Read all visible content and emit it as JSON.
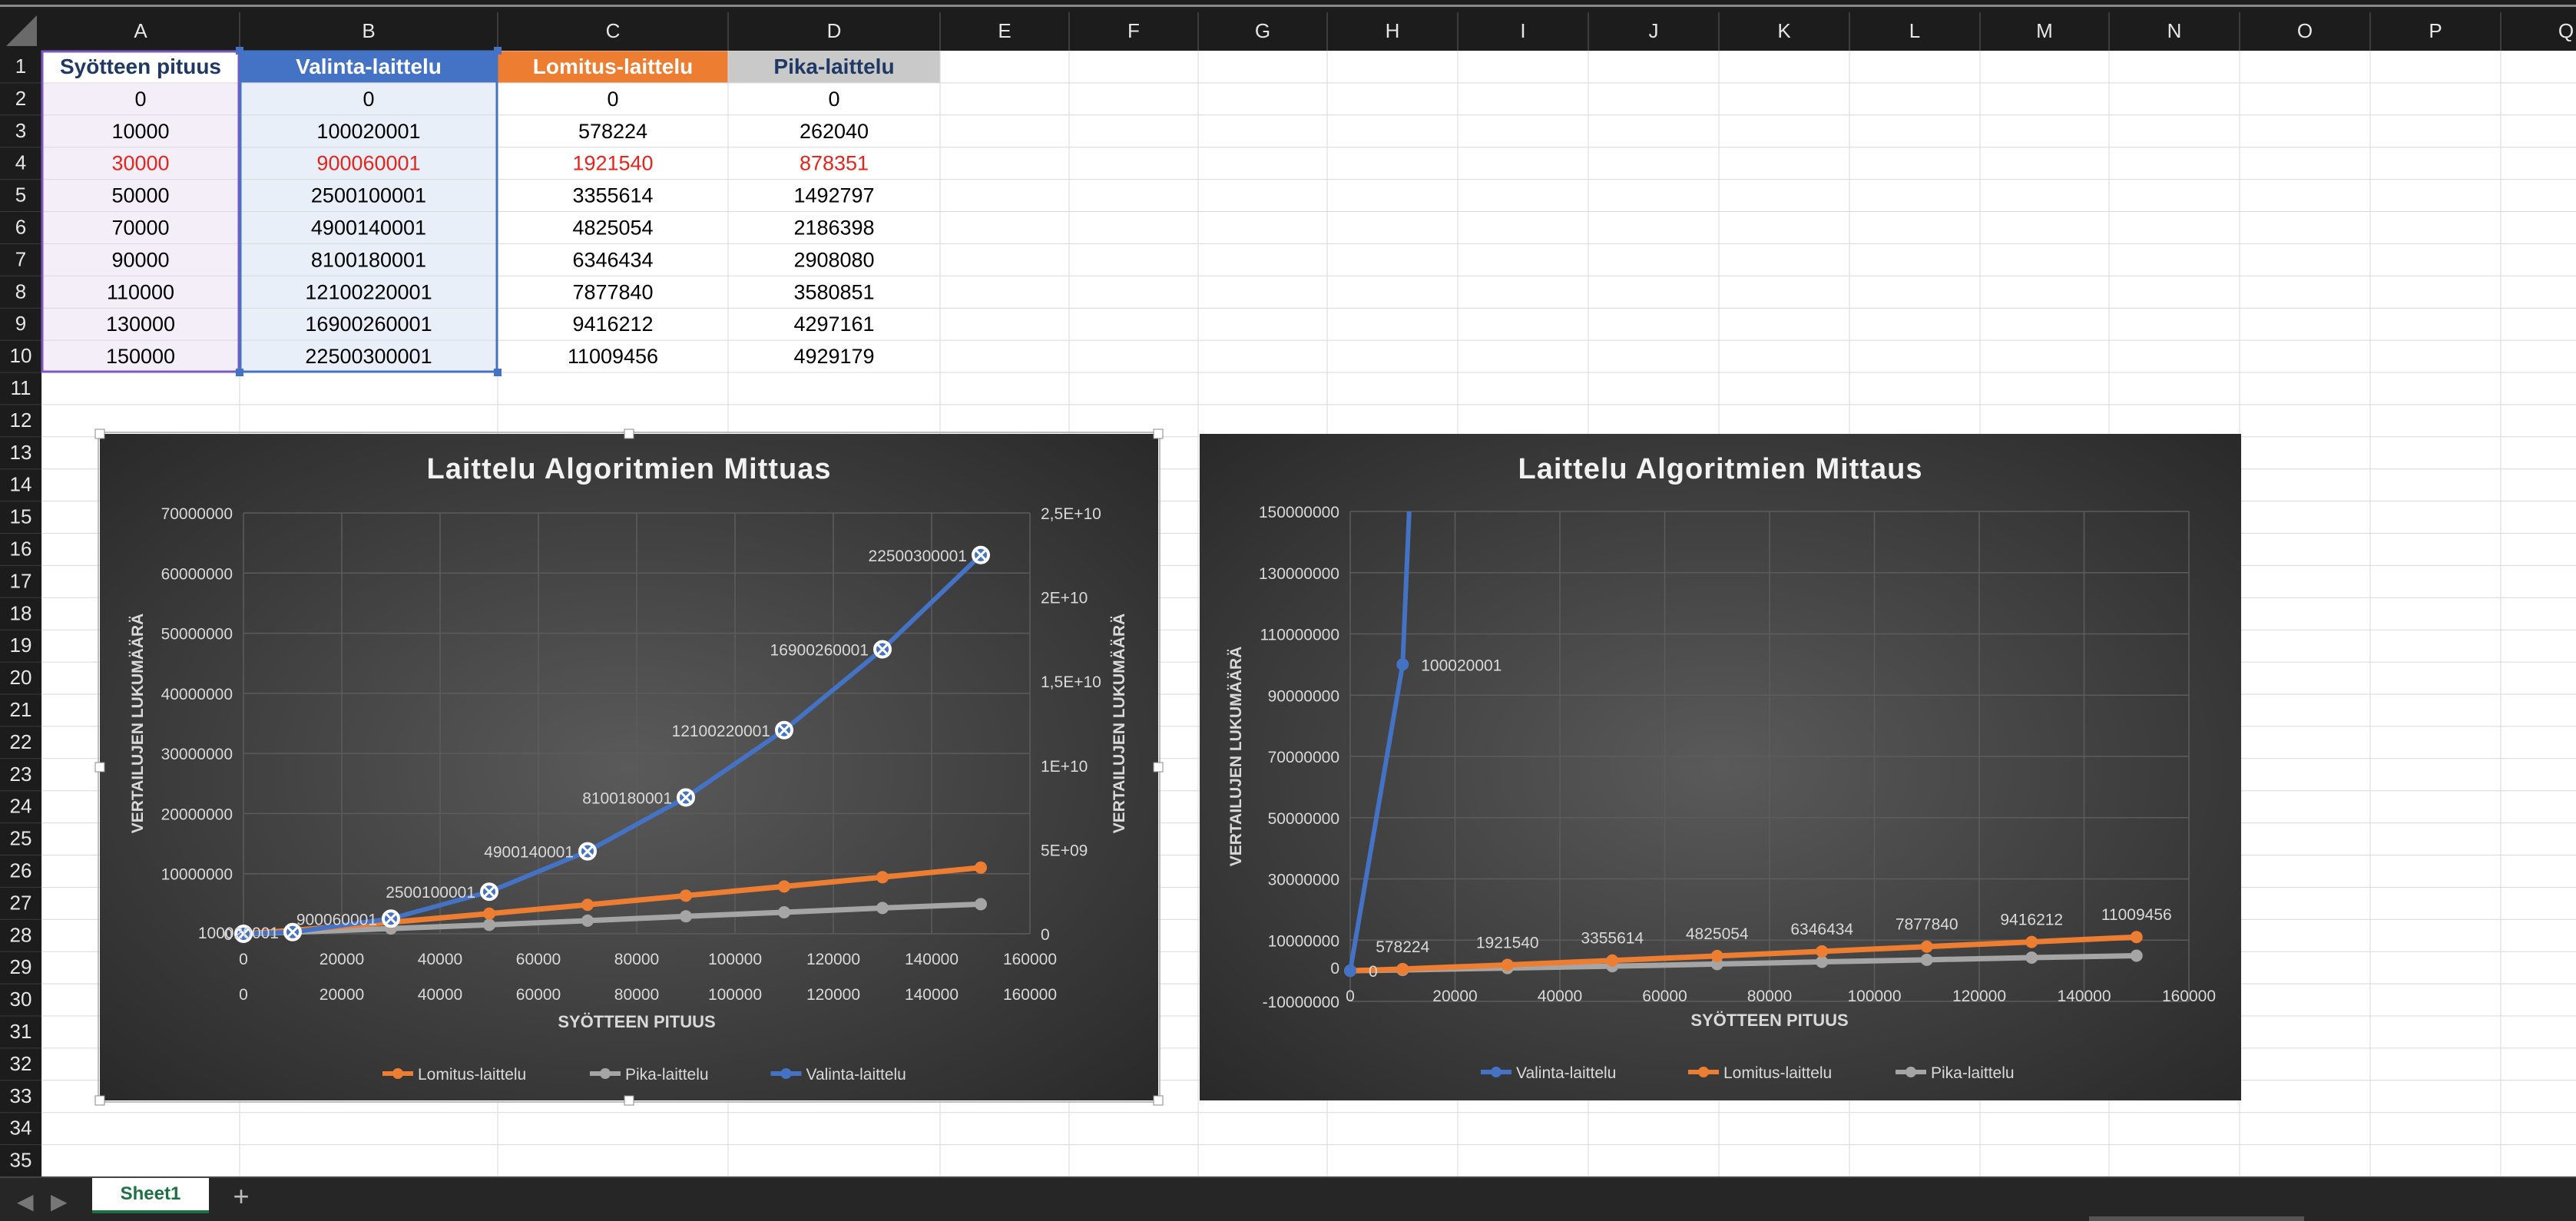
{
  "spreadsheet": {
    "columns": [
      "A",
      "B",
      "C",
      "D",
      "E",
      "F",
      "G",
      "H",
      "I",
      "J",
      "K",
      "L",
      "M",
      "N",
      "O",
      "P",
      "Q"
    ],
    "row_count": 35,
    "headers": [
      "Syötteen pituus",
      "Valinta-laittelu",
      "Lomitus-laittelu",
      "Pika-laittelu"
    ],
    "rows": [
      [
        "0",
        "0",
        "0",
        "0"
      ],
      [
        "10000",
        "100020001",
        "578224",
        "262040"
      ],
      [
        "30000",
        "900060001",
        "1921540",
        "878351"
      ],
      [
        "50000",
        "2500100001",
        "3355614",
        "1492797"
      ],
      [
        "70000",
        "4900140001",
        "4825054",
        "2186398"
      ],
      [
        "90000",
        "8100180001",
        "6346434",
        "2908080"
      ],
      [
        "110000",
        "12100220001",
        "7877840",
        "3580851"
      ],
      [
        "130000",
        "16900260001",
        "9416212",
        "4297161"
      ],
      [
        "150000",
        "22500300001",
        "11009456",
        "4929179"
      ]
    ],
    "highlighted_row_index": 2
  },
  "colors": {
    "header_a_text": "#1f3864",
    "header_b_bg": "#4472c4",
    "header_c_bg": "#ed7d31",
    "header_d_bg": "#c9c9c9",
    "col_a_bg": "#f3eef8",
    "col_b_bg": "#e9eff8",
    "highlight_text": "#e8241c",
    "blue": "#4472c4",
    "orange": "#ed7d31",
    "gray": "#a5a5a5",
    "chart_bg": "#3a3a3a"
  },
  "sheet_tabs": {
    "active": "Sheet1",
    "add": "+"
  },
  "nav": {
    "prev": "◀",
    "next": "▶"
  },
  "chart_data": [
    {
      "type": "line",
      "title": "Laittelu Algoritmien Mittuas",
      "xlabel": "SYÖTTEEN  PITUUS",
      "ylabel": "VERTAILUJEN LUKUMÄÄRÄ",
      "y2label": "VERTAILUJEN LUKUMÄÄRÄ",
      "x": [
        0,
        10000,
        30000,
        50000,
        70000,
        90000,
        110000,
        130000,
        150000
      ],
      "xlim": [
        0,
        160000
      ],
      "xticks": [
        "0",
        "20000",
        "40000",
        "60000",
        "80000",
        "100000",
        "120000",
        "140000",
        "160000"
      ],
      "ylim": [
        0,
        70000000
      ],
      "yticks": [
        "0",
        "10000000",
        "20000000",
        "30000000",
        "40000000",
        "50000000",
        "60000000",
        "70000000"
      ],
      "y2lim": [
        0,
        25000000000
      ],
      "y2ticks": [
        "0",
        "5E+09",
        "1E+10",
        "1,5E+10",
        "2E+10",
        "2,5E+10"
      ],
      "grid": true,
      "legend": "bottom",
      "series": [
        {
          "name": "Lomitus-laittelu",
          "axis": "primary",
          "values": [
            0,
            578224,
            1921540,
            3355614,
            4825054,
            6346434,
            7877840,
            9416212,
            11009456
          ]
        },
        {
          "name": "Pika-laittelu",
          "axis": "primary",
          "values": [
            0,
            262040,
            878351,
            1492797,
            2186398,
            2908080,
            3580851,
            4297161,
            4929179
          ]
        },
        {
          "name": "Valinta-laittelu",
          "axis": "secondary",
          "values": [
            0,
            100020001,
            900060001,
            2500100001,
            4900140001,
            8100180001,
            12100220001,
            16900260001,
            22500300001
          ],
          "labels": [
            "",
            "100020001",
            "900060001",
            "2500100001",
            "4900140001",
            "8100180001",
            "12100220001",
            "16900260001",
            "22500300001"
          ]
        }
      ]
    },
    {
      "type": "line",
      "title": "Laittelu Algoritmien Mittaus",
      "xlabel": "SYÖTTEEN PITUUS",
      "ylabel": "VERTAILUJEN LUKUMÄÄRÄ",
      "x": [
        0,
        10000,
        30000,
        50000,
        70000,
        90000,
        110000,
        130000,
        150000
      ],
      "xlim": [
        0,
        160000
      ],
      "xticks": [
        "0",
        "20000",
        "40000",
        "60000",
        "80000",
        "100000",
        "120000",
        "140000",
        "160000"
      ],
      "ylim": [
        -10000000,
        150000000
      ],
      "yticks": [
        "-10000000",
        "10000000",
        "30000000",
        "50000000",
        "70000000",
        "90000000",
        "110000000",
        "130000000",
        "150000000"
      ],
      "grid": true,
      "legend": "bottom",
      "series": [
        {
          "name": "Valinta-laittelu",
          "values": [
            0,
            100020001,
            900060001,
            2500100001,
            4900140001,
            8100180001,
            12100220001,
            16900260001,
            22500300001
          ],
          "labels": [
            "0",
            "100020001",
            "",
            "",
            "",
            "",
            "",
            "",
            ""
          ]
        },
        {
          "name": "Lomitus-laittelu",
          "values": [
            0,
            578224,
            1921540,
            3355614,
            4825054,
            6346434,
            7877840,
            9416212,
            11009456
          ],
          "labels": [
            "0",
            "578224",
            "1921540",
            "3355614",
            "4825054",
            "6346434",
            "7877840",
            "9416212",
            "11009456"
          ]
        },
        {
          "name": "Pika-laittelu",
          "values": [
            0,
            262040,
            878351,
            1492797,
            2186398,
            2908080,
            3580851,
            4297161,
            4929179
          ]
        }
      ]
    }
  ]
}
